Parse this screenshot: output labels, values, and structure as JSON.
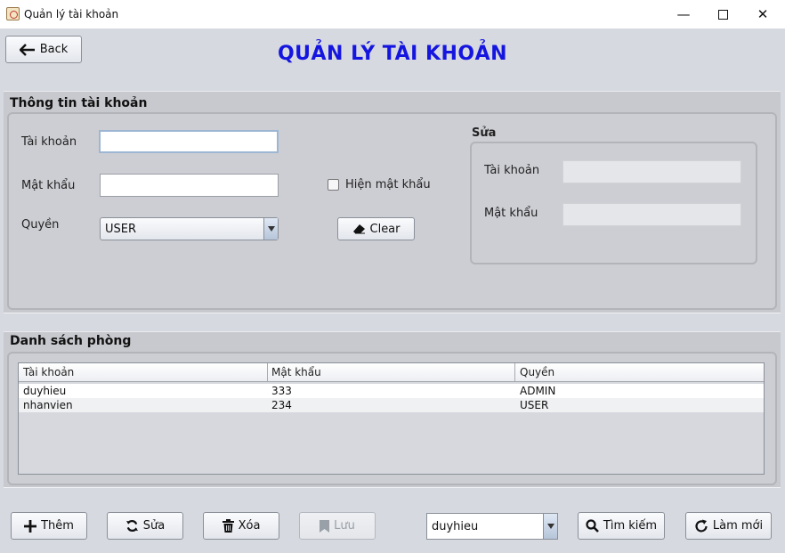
{
  "window": {
    "title": "Quản lý tài khoản",
    "minimize": "—",
    "close": "✕"
  },
  "header": {
    "back_label": "Back",
    "page_title": "QUẢN LÝ TÀI KHOẢN"
  },
  "account_info": {
    "section_title": "Thông tin tài khoản",
    "username_label": "Tài khoản",
    "username_value": "",
    "password_label": "Mật khẩu",
    "password_value": "",
    "show_password_label": "Hiện mật khẩu",
    "show_password_checked": false,
    "role_label": "Quyền",
    "role_value": "USER",
    "clear_label": "Clear"
  },
  "edit_box": {
    "title": "Sửa",
    "username_label": "Tài khoản",
    "username_value": "",
    "password_label": "Mật khẩu",
    "password_value": ""
  },
  "list": {
    "section_title": "Danh sách phòng",
    "columns": [
      "Tài khoản",
      "Mật khẩu",
      "Quyền"
    ],
    "rows": [
      [
        "duyhieu",
        "333",
        "ADMIN"
      ],
      [
        "nhanvien",
        "234",
        "USER"
      ]
    ]
  },
  "toolbar": {
    "add_label": "Thêm",
    "edit_label": "Sửa",
    "delete_label": "Xóa",
    "save_label": "Lưu",
    "search_select_value": "duyhieu",
    "search_label": "Tìm kiếm",
    "refresh_label": "Làm mới"
  },
  "colors": {
    "title_blue": "#1515e0",
    "background": "#d7d9e0"
  }
}
